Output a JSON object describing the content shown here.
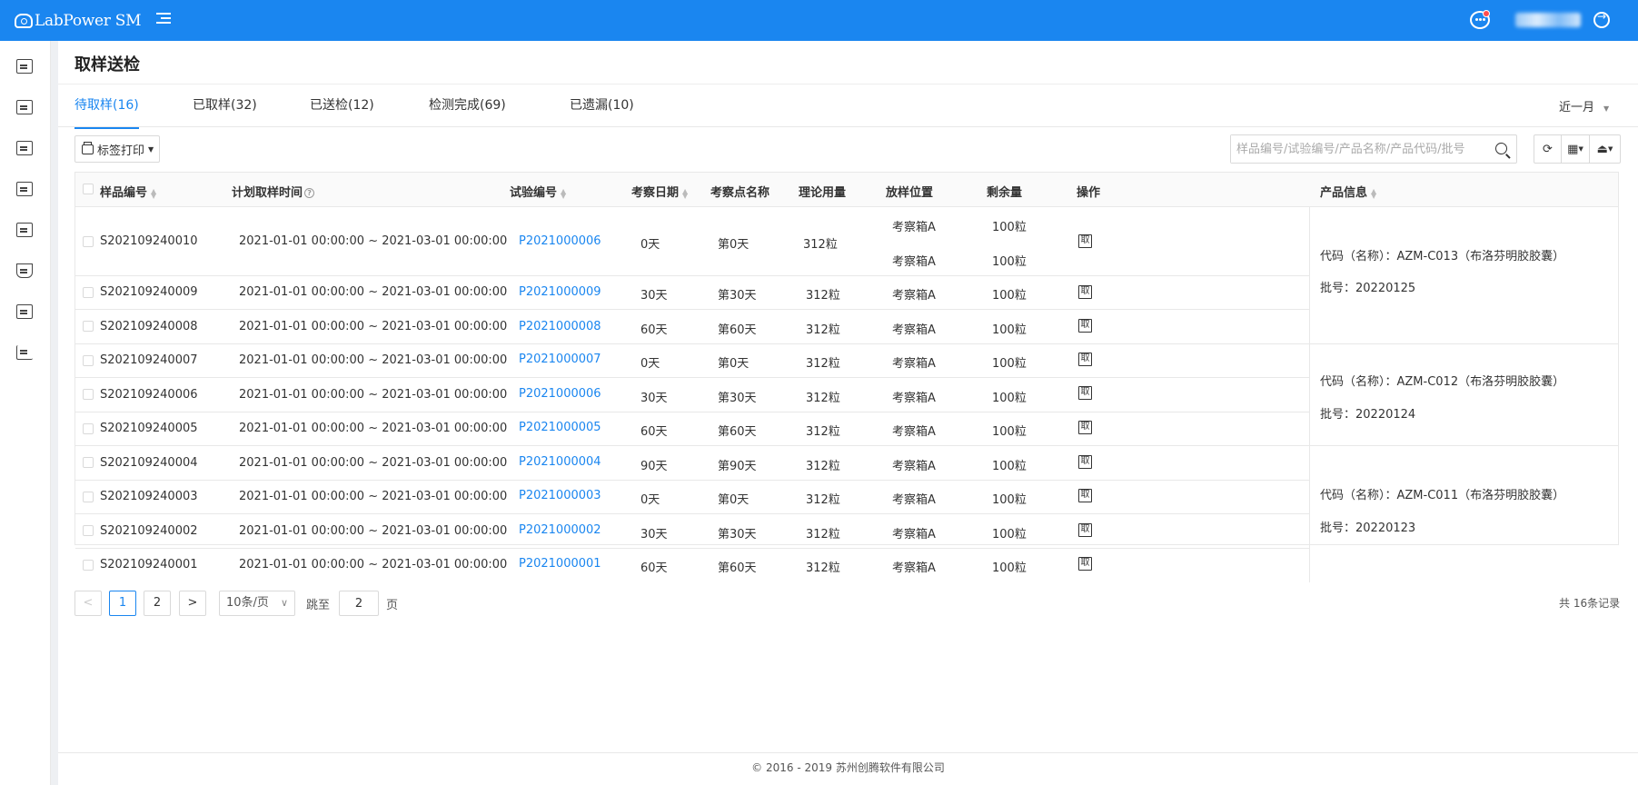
{
  "app": {
    "logo_text": "LabPower SM"
  },
  "header": {
    "message_icon": "chat-bubble-icon",
    "logout_icon": "logout-icon"
  },
  "sidebar": {
    "icons": [
      "sample-icon",
      "list-check-icon",
      "form-icon",
      "monitor-icon",
      "report-icon",
      "flask-icon",
      "layout-icon",
      "chart-icon"
    ]
  },
  "page": {
    "title": "取样送检"
  },
  "tabs": [
    {
      "label": "待取样(16)",
      "active": true
    },
    {
      "label": "已取样(32)"
    },
    {
      "label": "已送检(12)"
    },
    {
      "label": "检测完成(69)"
    },
    {
      "label": "已遗漏(10)"
    }
  ],
  "range": {
    "selected": "近一月"
  },
  "toolbar": {
    "print_label": "标签打印",
    "search_placeholder": "样品编号/试验编号/产品名称/产品代码/批号"
  },
  "table": {
    "headers": {
      "sample_no": "样品编号",
      "plan_time": "计划取样时间",
      "test_no": "试验编号",
      "date": "考察日期",
      "point": "考察点名称",
      "amount": "理论用量",
      "location": "放样位置",
      "remaining": "剩余量",
      "action": "操作",
      "product": "产品信息"
    },
    "action_label": "取",
    "rows": [
      {
        "sample_no": "S202109240010",
        "plan_time": "2021-01-01 00:00:00 ~ 2021-03-01 00:00:00",
        "test_no": "P2021000006",
        "date": "0天",
        "point": "第0天",
        "amount": "312粒",
        "location": "考察箱A",
        "location2": "考察箱A",
        "remaining": "100粒",
        "remaining2": "100粒"
      },
      {
        "sample_no": "S202109240009",
        "plan_time": "2021-01-01 00:00:00 ~ 2021-03-01 00:00:00",
        "test_no": "P2021000009",
        "date": "30天",
        "point": "第30天",
        "amount": "312粒",
        "location": "考察箱A",
        "remaining": "100粒"
      },
      {
        "sample_no": "S202109240008",
        "plan_time": "2021-01-01 00:00:00 ~ 2021-03-01 00:00:00",
        "test_no": "P2021000008",
        "date": "60天",
        "point": "第60天",
        "amount": "312粒",
        "location": "考察箱A",
        "remaining": "100粒"
      },
      {
        "sample_no": "S202109240007",
        "plan_time": "2021-01-01 00:00:00 ~ 2021-03-01 00:00:00",
        "test_no": "P2021000007",
        "date": "0天",
        "point": "第0天",
        "amount": "312粒",
        "location": "考察箱A",
        "remaining": "100粒"
      },
      {
        "sample_no": "S202109240006",
        "plan_time": "2021-01-01 00:00:00 ~ 2021-03-01 00:00:00",
        "test_no": "P2021000006",
        "date": "30天",
        "point": "第30天",
        "amount": "312粒",
        "location": "考察箱A",
        "remaining": "100粒"
      },
      {
        "sample_no": "S202109240005",
        "plan_time": "2021-01-01 00:00:00 ~ 2021-03-01 00:00:00",
        "test_no": "P2021000005",
        "date": "60天",
        "point": "第60天",
        "amount": "312粒",
        "location": "考察箱A",
        "remaining": "100粒"
      },
      {
        "sample_no": "S202109240004",
        "plan_time": "2021-01-01 00:00:00 ~ 2021-03-01 00:00:00",
        "test_no": "P2021000004",
        "date": "90天",
        "point": "第90天",
        "amount": "312粒",
        "location": "考察箱A",
        "remaining": "100粒"
      },
      {
        "sample_no": "S202109240003",
        "plan_time": "2021-01-01 00:00:00 ~ 2021-03-01 00:00:00",
        "test_no": "P2021000003",
        "date": "0天",
        "point": "第0天",
        "amount": "312粒",
        "location": "考察箱A",
        "remaining": "100粒"
      },
      {
        "sample_no": "S202109240002",
        "plan_time": "2021-01-01 00:00:00 ~ 2021-03-01 00:00:00",
        "test_no": "P2021000002",
        "date": "30天",
        "point": "第30天",
        "amount": "312粒",
        "location": "考察箱A",
        "remaining": "100粒"
      },
      {
        "sample_no": "S202109240001",
        "plan_time": "2021-01-01 00:00:00 ~ 2021-03-01 00:00:00",
        "test_no": "P2021000001",
        "date": "60天",
        "point": "第60天",
        "amount": "312粒",
        "location": "考察箱A",
        "remaining": "100粒"
      }
    ],
    "products": [
      {
        "code": "代码（名称）：AZM-C013（布洛芬明胶胶囊）",
        "batch": "批号：20220125"
      },
      {
        "code": "代码（名称）：AZM-C012（布洛芬明胶胶囊）",
        "batch": "批号：20220124"
      },
      {
        "code": "代码（名称）：AZM-C011（布洛芬明胶胶囊）",
        "batch": "批号：20220123"
      }
    ]
  },
  "pagination": {
    "prev": "<",
    "pages": [
      "1",
      "2"
    ],
    "next": ">",
    "page_size": "10条/页",
    "jump_label": "跳至",
    "jump_value": "2",
    "jump_suffix": "页",
    "total": "共 16条记录"
  },
  "footer": {
    "copyright": "© 2016 - 2019 苏州创腾软件有限公司"
  },
  "colors": {
    "primary": "#1a86f0",
    "danger": "#ff4d4f"
  }
}
